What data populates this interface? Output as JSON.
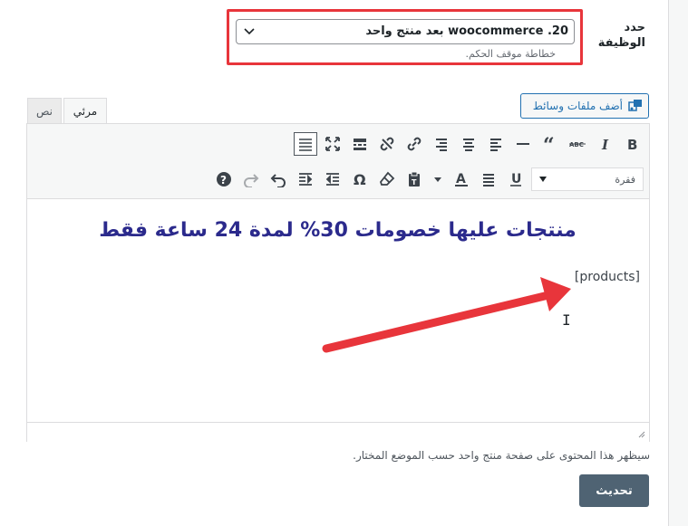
{
  "field": {
    "label": "حدد الوظيفة",
    "selected": "20. woocommerce بعد منتج واحد",
    "helper": "خطاطة موقف الحكم."
  },
  "media_button": {
    "label": "أضف ملفات وسائط"
  },
  "tabs": [
    {
      "label": "مرئي",
      "active": true
    },
    {
      "label": "نص",
      "active": false
    }
  ],
  "toolbar": {
    "row1_icons": [
      "bold-icon",
      "italic-icon",
      "strikethrough-icon",
      "quote-icon",
      "horizontal-line-icon",
      "align-left-icon",
      "align-center-icon",
      "align-right-icon",
      "link-icon",
      "unlink-icon",
      "read-more-icon",
      "fullscreen-icon",
      "toolbar-toggle-icon"
    ],
    "row2_icons": [
      "underline-icon",
      "justify-icon",
      "text-color-icon",
      "paste-text-icon",
      "clear-formatting-icon",
      "special-character-icon",
      "outdent-icon",
      "indent-icon",
      "undo-icon",
      "redo-icon",
      "help-icon"
    ],
    "format_select": "فقرة"
  },
  "editor": {
    "heading": "منتجات عليها خصومات 30% لمدة 24 ساعة فقط",
    "shortcode": "[products]"
  },
  "description": "سيظهر هذا المحتوى على صفحة منتج واحد حسب الموضع المختار.",
  "update_button": {
    "label": "تحديث"
  },
  "colors": {
    "highlight_border": "#e8353b",
    "heading_text": "#2b2a8c",
    "annotation_arrow": "#e8353b",
    "update_button_bg": "#4f6373",
    "link_blue": "#2271b1"
  }
}
